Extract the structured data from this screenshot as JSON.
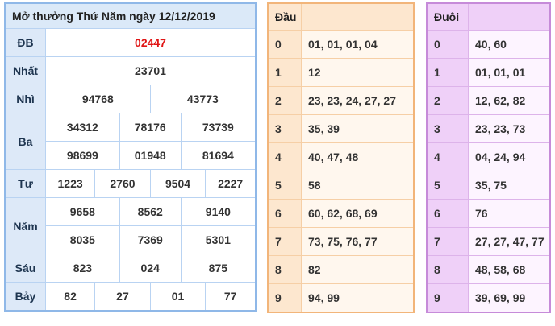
{
  "results": {
    "title": "Mở thưởng Thứ Năm ngày 12/12/2019",
    "db_label": "ĐB",
    "db": "02447",
    "nhat_label": "Nhất",
    "nhat": "23701",
    "nhi_label": "Nhì",
    "nhi": [
      "94768",
      "43773"
    ],
    "ba_label": "Ba",
    "ba": [
      "34312",
      "78176",
      "73739",
      "98699",
      "01948",
      "81694"
    ],
    "tu_label": "Tư",
    "tu": [
      "1223",
      "2760",
      "9504",
      "2227"
    ],
    "nam_label": "Năm",
    "nam": [
      "9658",
      "8562",
      "9140",
      "8035",
      "7369",
      "5301"
    ],
    "sau_label": "Sáu",
    "sau": [
      "823",
      "024",
      "875"
    ],
    "bay_label": "Bảy",
    "bay": [
      "82",
      "27",
      "01",
      "77"
    ]
  },
  "dau": {
    "header": "Đầu",
    "rows": [
      {
        "k": "0",
        "v": "01, 01, 01, 04"
      },
      {
        "k": "1",
        "v": "12"
      },
      {
        "k": "2",
        "v": "23, 23, 24, 27, 27"
      },
      {
        "k": "3",
        "v": "35, 39"
      },
      {
        "k": "4",
        "v": "40, 47, 48"
      },
      {
        "k": "5",
        "v": "58"
      },
      {
        "k": "6",
        "v": "60, 62, 68, 69"
      },
      {
        "k": "7",
        "v": "73, 75, 76, 77"
      },
      {
        "k": "8",
        "v": "82"
      },
      {
        "k": "9",
        "v": "94, 99"
      }
    ]
  },
  "duoi": {
    "header": "Đuôi",
    "rows": [
      {
        "k": "0",
        "v": "40, 60"
      },
      {
        "k": "1",
        "v": "01, 01, 01"
      },
      {
        "k": "2",
        "v": "12, 62, 82"
      },
      {
        "k": "3",
        "v": "23, 23, 73"
      },
      {
        "k": "4",
        "v": "04, 24, 94"
      },
      {
        "k": "5",
        "v": "35, 75"
      },
      {
        "k": "6",
        "v": "76"
      },
      {
        "k": "7",
        "v": "27, 27, 47, 77"
      },
      {
        "k": "8",
        "v": "48, 58, 68"
      },
      {
        "k": "9",
        "v": "39, 69, 99"
      }
    ]
  }
}
